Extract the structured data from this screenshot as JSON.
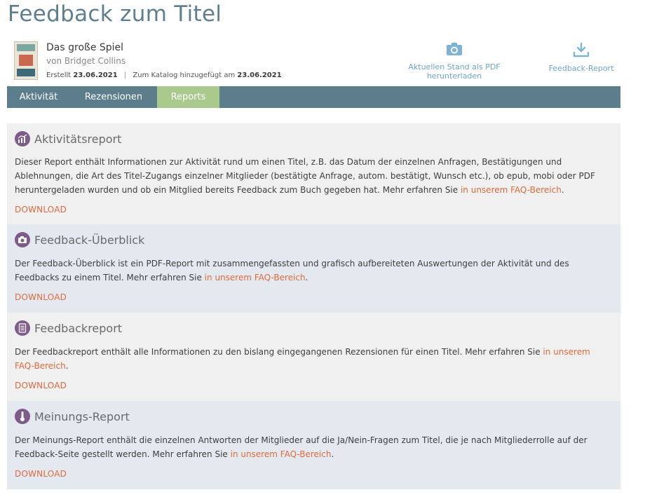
{
  "page": {
    "title": "Feedback zum Titel"
  },
  "book": {
    "title": "Das große Spiel",
    "author": "von Bridget Collins",
    "created_label": "Erstellt",
    "created_date": "23.06.2021",
    "separator": "|",
    "catalog_label": "Zum Katalog hinzugefügt am",
    "catalog_date": "23.06.2021"
  },
  "actions": {
    "pdf_label": "Aktuellen Stand als PDF herunterladen",
    "pdf_icon": "camera-icon",
    "report_label": "Feedback-Report",
    "report_icon": "download-icon"
  },
  "tabs": [
    {
      "label": "Aktivität",
      "active": false
    },
    {
      "label": "Rezensionen",
      "active": false
    },
    {
      "label": "Reports",
      "active": true
    }
  ],
  "colors": {
    "accent": "#e06a3e",
    "tabbar": "#5c7d8c",
    "active_tab": "#a9c98d",
    "icon_bg": "#7d5c8c",
    "title": "#5f7f8f"
  },
  "reports": [
    {
      "title": "Aktivitätsreport",
      "icon": "chart-icon",
      "text": "Dieser Report enthält Informationen zur Aktivität rund um einen Titel, z.B. das Datum der einzelnen Anfragen, Bestätigungen und Ablehnungen, die Art des Titel-Zugangs einzelner Mitglieder (bestätigte Anfrage, autom. bestätigt, Wunsch etc.), ob epub, mobi oder PDF heruntergeladen wurden und ob ein Mitglied bereits Feedback zum Buch gegeben hat. Mehr erfahren Sie ",
      "link": "in unserem FAQ-Bereich",
      "trail": ".",
      "download": "DOWNLOAD"
    },
    {
      "title": "Feedback-Überblick",
      "icon": "camera-icon",
      "text": "Der Feedback-Überblick ist ein PDF-Report mit zusammengefassten und grafisch aufbereiteten Auswertungen der Aktivität und des Feedbacks zu einem Titel. Mehr erfahren Sie ",
      "link": "in unserem FAQ-Bereich",
      "trail": ".",
      "download": "DOWNLOAD"
    },
    {
      "title": "Feedbackreport",
      "icon": "document-icon",
      "text": "Der Feedbackreport enthält alle Informationen zu den bislang eingegangenen Rezensionen für einen Titel. Mehr erfahren Sie ",
      "link": "in unserem FAQ-Bereich",
      "trail": ".",
      "download": "DOWNLOAD"
    },
    {
      "title": "Meinungs-Report",
      "icon": "thermometer-icon",
      "text": "Der Meinungs-Report enthält die einzelnen Antworten der Mitglieder auf die Ja/Nein-Fragen zum Titel, die je nach Mitgliederrolle auf der Feedback-Seite gestellt werden. Mehr erfahren Sie ",
      "link": "in unserem FAQ-Bereich",
      "trail": ".",
      "download": "DOWNLOAD"
    }
  ]
}
